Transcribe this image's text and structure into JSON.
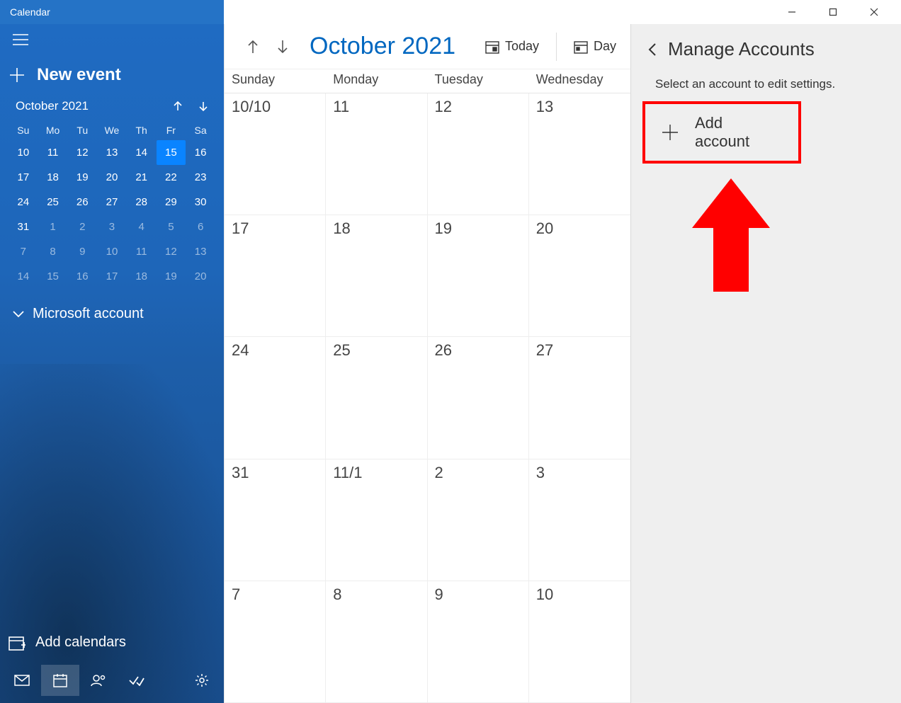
{
  "title": "Calendar",
  "sidebar": {
    "new_event": "New event",
    "mini_month": "October 2021",
    "weekdays": [
      "Su",
      "Mo",
      "Tu",
      "We",
      "Th",
      "Fr",
      "Sa"
    ],
    "today": 15,
    "weeks": [
      [
        {
          "d": 10
        },
        {
          "d": 11
        },
        {
          "d": 12
        },
        {
          "d": 13
        },
        {
          "d": 14
        },
        {
          "d": 15
        },
        {
          "d": 16
        }
      ],
      [
        {
          "d": 17
        },
        {
          "d": 18
        },
        {
          "d": 19
        },
        {
          "d": 20
        },
        {
          "d": 21
        },
        {
          "d": 22
        },
        {
          "d": 23
        }
      ],
      [
        {
          "d": 24
        },
        {
          "d": 25
        },
        {
          "d": 26
        },
        {
          "d": 27
        },
        {
          "d": 28
        },
        {
          "d": 29
        },
        {
          "d": 30
        }
      ],
      [
        {
          "d": 31
        },
        {
          "d": 1,
          "dim": true
        },
        {
          "d": 2,
          "dim": true
        },
        {
          "d": 3,
          "dim": true
        },
        {
          "d": 4,
          "dim": true
        },
        {
          "d": 5,
          "dim": true
        },
        {
          "d": 6,
          "dim": true
        }
      ],
      [
        {
          "d": 7,
          "dim": true
        },
        {
          "d": 8,
          "dim": true
        },
        {
          "d": 9,
          "dim": true
        },
        {
          "d": 10,
          "dim": true
        },
        {
          "d": 11,
          "dim": true
        },
        {
          "d": 12,
          "dim": true
        },
        {
          "d": 13,
          "dim": true
        }
      ],
      [
        {
          "d": 14,
          "dim": true
        },
        {
          "d": 15,
          "dim": true
        },
        {
          "d": 16,
          "dim": true
        },
        {
          "d": 17,
          "dim": true
        },
        {
          "d": 18,
          "dim": true
        },
        {
          "d": 19,
          "dim": true
        },
        {
          "d": 20,
          "dim": true
        }
      ]
    ],
    "account_label": "Microsoft account",
    "add_calendars": "Add calendars"
  },
  "toolbar": {
    "month_title": "October 2021",
    "today": "Today",
    "view": "Day"
  },
  "grid": {
    "day_headers": [
      "Sunday",
      "Monday",
      "Tuesday",
      "Wednesday"
    ],
    "rows": [
      [
        "10/10",
        "11",
        "12",
        "13"
      ],
      [
        "17",
        "18",
        "19",
        "20"
      ],
      [
        "24",
        "25",
        "26",
        "27"
      ],
      [
        "31",
        "11/1",
        "2",
        "3"
      ],
      [
        "7",
        "8",
        "9",
        "10"
      ]
    ]
  },
  "panel": {
    "title": "Manage Accounts",
    "subtitle": "Select an account to edit settings.",
    "add_account": "Add account"
  }
}
